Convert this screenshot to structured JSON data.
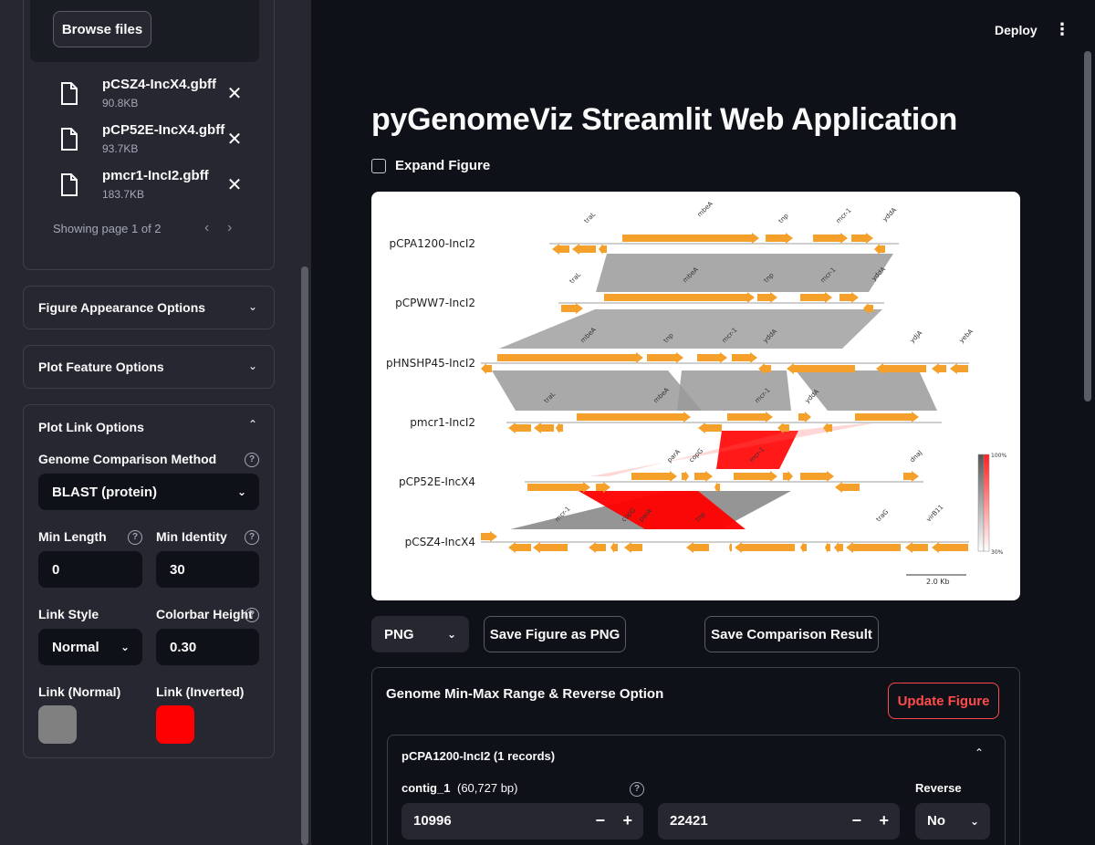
{
  "sidebar": {
    "upload": {
      "browse_label": "Browse files",
      "files": [
        {
          "name": "pCSZ4-IncX4.gbff",
          "size": "90.8KB"
        },
        {
          "name": "pCP52E-IncX4.gbff",
          "size": "93.7KB"
        },
        {
          "name": "pmcr1-IncI2.gbff",
          "size": "183.7KB"
        }
      ],
      "pager_text": "Showing page 1 of 2"
    },
    "expanders": {
      "appearance": "Figure Appearance Options",
      "feature": "Plot Feature Options",
      "link": "Plot Link Options"
    },
    "link_options": {
      "method_label": "Genome Comparison Method",
      "method_value": "BLAST (protein)",
      "min_length_label": "Min Length",
      "min_length_value": "0",
      "min_identity_label": "Min Identity",
      "min_identity_value": "30",
      "link_style_label": "Link Style",
      "link_style_value": "Normal",
      "colorbar_label": "Colorbar Height",
      "colorbar_value": "0.30",
      "normal_label": "Link (Normal)",
      "normal_color": "#808080",
      "inverted_label": "Link (Inverted)",
      "inverted_color": "#ff0000"
    }
  },
  "header": {
    "deploy": "Deploy",
    "menu_icon": "⋮"
  },
  "main": {
    "title": "pyGenomeViz Streamlit Web Application",
    "expand_label": "Expand Figure",
    "figure": {
      "tracks": [
        {
          "name": "pCPA1200-IncI2"
        },
        {
          "name": "pCPWW7-IncI2"
        },
        {
          "name": "pHNSHP45-IncI2"
        },
        {
          "name": "pmcr1-IncI2"
        },
        {
          "name": "pCP52E-IncX4"
        },
        {
          "name": "pCSZ4-IncX4"
        }
      ],
      "gene_labels": [
        {
          "text": "traL"
        },
        {
          "text": "mbeA"
        },
        {
          "text": "tnp"
        },
        {
          "text": "mcr-1"
        },
        {
          "text": "yddA"
        },
        {
          "text": "traL"
        },
        {
          "text": "mbeA"
        },
        {
          "text": "tnp"
        },
        {
          "text": "mcr-1"
        },
        {
          "text": "yddA"
        },
        {
          "text": "mbeA"
        },
        {
          "text": "tnp"
        },
        {
          "text": "mcr-1"
        },
        {
          "text": "yddA"
        },
        {
          "text": "ydjA"
        },
        {
          "text": "yebA"
        },
        {
          "text": "traL"
        },
        {
          "text": "mbeA"
        },
        {
          "text": "mcr-1"
        },
        {
          "text": "yddA"
        },
        {
          "text": "parA"
        },
        {
          "text": "copG"
        },
        {
          "text": "mcr-1"
        },
        {
          "text": "dnaJ"
        },
        {
          "text": "mcr-1"
        },
        {
          "text": "copG"
        },
        {
          "text": "parA"
        },
        {
          "text": "tnp"
        },
        {
          "text": "traG"
        },
        {
          "text": "virB11"
        }
      ],
      "colorbar_max": "100%",
      "colorbar_min": "30%",
      "scalebar": "2.0 Kb",
      "gene_color": "#f5a02a",
      "link_normal_color": "#808080",
      "link_inverted_color": "#ff0000"
    },
    "format_value": "PNG",
    "save_fig_label": "Save Figure as PNG",
    "save_cmp_label": "Save Comparison Result",
    "range": {
      "title": "Genome Min-Max Range & Reverse Option",
      "update_label": "Update Figure",
      "record_title": "pCPA1200-IncI2 (1 records)",
      "contig_name": "contig_1",
      "contig_len": "(60,727 bp)",
      "min_value": "10996",
      "max_value": "22421",
      "reverse_label": "Reverse",
      "reverse_value": "No"
    }
  }
}
